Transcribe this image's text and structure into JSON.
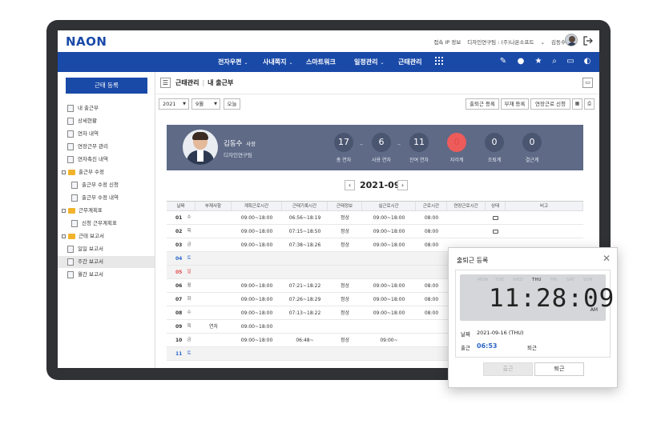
{
  "header": {
    "logo": "NAON",
    "ip_info": "접속 IP 정보",
    "org": "디자인연구팀 : (주)나온소프트",
    "user": "김동수"
  },
  "nav": {
    "items": [
      "전자우편",
      "사내쪽지",
      "스마트워크",
      "일정관리",
      "근태관리"
    ],
    "caret": "⌄"
  },
  "sidebar": {
    "register_button": "근태 등록",
    "items": [
      {
        "label": "내 출근부",
        "level": 1,
        "icon": "doc-icon"
      },
      {
        "label": "상세현황",
        "level": 1,
        "icon": "doc-icon"
      },
      {
        "label": "연차 내역",
        "level": 1,
        "icon": "calendar-icon"
      },
      {
        "label": "연장근무 관리",
        "level": 1,
        "icon": "clock-icon"
      },
      {
        "label": "연차촉진 내역",
        "level": 1,
        "icon": "check-icon"
      },
      {
        "label": "출근부 수정",
        "level": 0,
        "icon": "folder-icon"
      },
      {
        "label": "출근부 수정 신청",
        "level": 2,
        "icon": "doc-icon"
      },
      {
        "label": "출근부 수정 내역",
        "level": 2,
        "icon": "doc-icon"
      },
      {
        "label": "근무계획표",
        "level": 0,
        "icon": "folder-icon"
      },
      {
        "label": "신청 근무계획표",
        "level": 2,
        "icon": "doc-icon"
      },
      {
        "label": "근태 보고서",
        "level": 0,
        "icon": "folder-icon"
      },
      {
        "label": "일일 보고서",
        "level": 1,
        "icon": "doc-icon"
      },
      {
        "label": "주간 보고서",
        "level": 1,
        "icon": "doc-icon",
        "active": true
      },
      {
        "label": "월간 보고서",
        "level": 1,
        "icon": "doc-icon"
      }
    ]
  },
  "breadcrumb": {
    "section": "근태관리",
    "page": "내 출근부"
  },
  "filters": {
    "year": "2021",
    "month": "9월",
    "today_button": "오늘",
    "clock_button": "출퇴근 등록",
    "absence_button": "부재 등록",
    "overtime_button": "연장근로 신청"
  },
  "profile": {
    "name": "김동수",
    "title": "사장",
    "dept": "디자인연구팀",
    "stats": [
      {
        "value": "17",
        "label": "총 연차"
      },
      {
        "value": "6",
        "label": "사용 연차"
      },
      {
        "value": "11",
        "label": "잔여 연차"
      },
      {
        "value": "0",
        "label": "지각계",
        "highlight": true
      },
      {
        "value": "0",
        "label": "조퇴계"
      },
      {
        "value": "0",
        "label": "결근계"
      }
    ]
  },
  "month_nav": {
    "label": "2021-09",
    "prev": "‹",
    "next": "›"
  },
  "table": {
    "headers": [
      "날짜",
      "부재사항",
      "계획근로시간",
      "근태기록시간",
      "근태정보",
      "실근로시간",
      "근로시간",
      "연장근로시간",
      "상태",
      "비고"
    ],
    "rows": [
      {
        "day": "01",
        "wd": "수",
        "absence": "",
        "plan": "09:00~18:00",
        "record": "06:56~18:19",
        "info": "정상",
        "actual": "09:00~18:00",
        "hours": "08:00",
        "ot": "",
        "status": true
      },
      {
        "day": "02",
        "wd": "목",
        "absence": "",
        "plan": "09:00~18:00",
        "record": "07:15~18:50",
        "info": "정상",
        "actual": "09:00~18:00",
        "hours": "08:00",
        "ot": "",
        "status": true
      },
      {
        "day": "03",
        "wd": "금",
        "absence": "",
        "plan": "09:00~18:00",
        "record": "07:38~18:26",
        "info": "정상",
        "actual": "09:00~18:00",
        "hours": "08:00",
        "ot": "",
        "status": false
      },
      {
        "day": "04",
        "wd": "토",
        "absence": "",
        "plan": "",
        "record": "",
        "info": "",
        "actual": "",
        "hours": "",
        "ot": "",
        "status": false,
        "type": "sat"
      },
      {
        "day": "05",
        "wd": "일",
        "absence": "",
        "plan": "",
        "record": "",
        "info": "",
        "actual": "",
        "hours": "",
        "ot": "",
        "status": false,
        "type": "sun"
      },
      {
        "day": "06",
        "wd": "월",
        "absence": "",
        "plan": "09:00~18:00",
        "record": "07:21~18:22",
        "info": "정상",
        "actual": "09:00~18:00",
        "hours": "08:00",
        "ot": "",
        "status": false
      },
      {
        "day": "07",
        "wd": "화",
        "absence": "",
        "plan": "09:00~18:00",
        "record": "07:26~18:29",
        "info": "정상",
        "actual": "09:00~18:00",
        "hours": "08:00",
        "ot": "",
        "status": false
      },
      {
        "day": "08",
        "wd": "수",
        "absence": "",
        "plan": "09:00~18:00",
        "record": "07:13~18:22",
        "info": "정상",
        "actual": "09:00~18:00",
        "hours": "08:00",
        "ot": "",
        "status": false
      },
      {
        "day": "09",
        "wd": "목",
        "absence": "연차",
        "plan": "09:00~18:00",
        "record": "",
        "info": "",
        "actual": "",
        "hours": "",
        "ot": "",
        "status": false
      },
      {
        "day": "10",
        "wd": "금",
        "absence": "",
        "plan": "09:00~18:00",
        "record": "06:48~",
        "info": "정상",
        "actual": "09:00~",
        "hours": "",
        "ot": "",
        "status": false
      },
      {
        "day": "11",
        "wd": "토",
        "absence": "",
        "plan": "",
        "record": "",
        "info": "",
        "actual": "",
        "hours": "",
        "ot": "",
        "status": false,
        "type": "sat"
      }
    ]
  },
  "popup": {
    "title": "출퇴근 등록",
    "days": [
      "MON",
      "TUE",
      "WED",
      "THU",
      "FRI",
      "SAT",
      "SUN"
    ],
    "active_day": "THU",
    "time": "11:28:09",
    "ampm": "AM",
    "date_label": "날짜",
    "date_value": "2021-09-16 (THU)",
    "in_label": "출근",
    "in_value": "06:53",
    "out_label": "퇴근",
    "in_button": "출근",
    "out_button": "퇴근"
  },
  "colors": {
    "brand": "#1a4aa8",
    "card": "#5e6a86",
    "late": "#ee5b5b",
    "saturday": "#2b66c9",
    "sunday": "#e24b4b"
  }
}
